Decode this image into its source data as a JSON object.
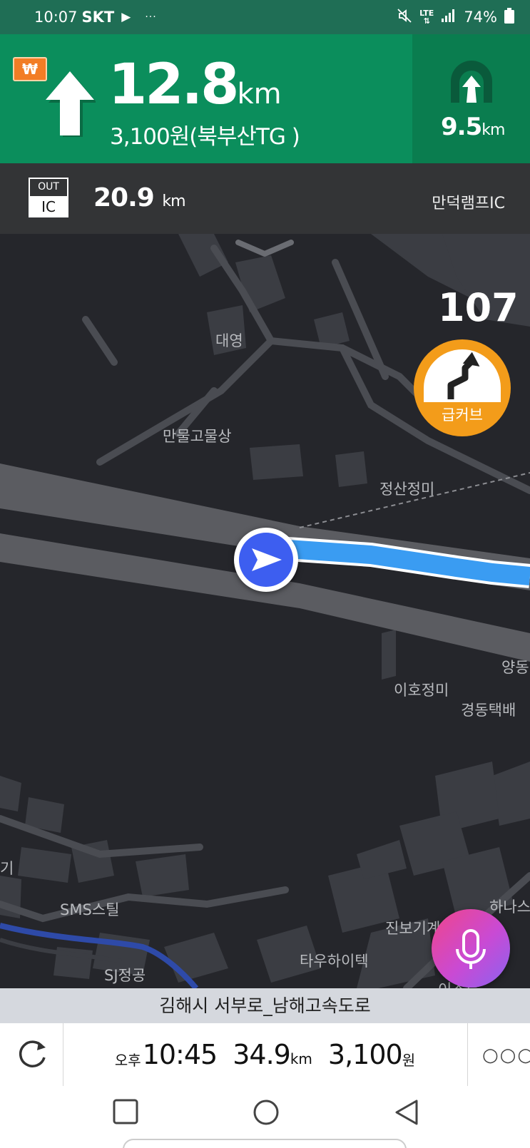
{
  "status_bar": {
    "time": "10:07",
    "carrier": "SKT",
    "battery": "74%",
    "dots": "···"
  },
  "guidance": {
    "toll_icon_symbol": "₩",
    "distance_value": "12.8",
    "distance_unit": "km",
    "toll_text": "3,100원(북부산TG )",
    "next_turn_icon": "straight-arrow-icon",
    "tunnel_icon": "tunnel-icon",
    "tunnel_distance_value": "9.5",
    "tunnel_distance_unit": "km",
    "accent_color": "#0b8e5c"
  },
  "exit": {
    "badge_top": "OUT",
    "badge_bottom": "IC",
    "distance_value": "20.9",
    "distance_unit": "km",
    "name": "만덕램프IC"
  },
  "map": {
    "speed_limit": "107",
    "curve_warning_label": "급커브",
    "route_color": "#3a9cf2",
    "labels": [
      {
        "text": "대영"
      },
      {
        "text": "만물고물상"
      },
      {
        "text": "정산정미"
      },
      {
        "text": "양동"
      },
      {
        "text": "이호정미"
      },
      {
        "text": "경동택배"
      },
      {
        "text": "SMS스틸"
      },
      {
        "text": "진보기계"
      },
      {
        "text": "하나스"
      },
      {
        "text": "타우하이텍"
      },
      {
        "text": "기"
      },
      {
        "text": "SJ정공"
      },
      {
        "text": "이스트"
      }
    ]
  },
  "road_name": "김해시 서부로_남해고속도로",
  "info_bar": {
    "eta_prefix": "오후",
    "eta_time": "10:45",
    "remaining_distance": "34.9",
    "remaining_distance_unit": "km",
    "toll_total": "3,100",
    "toll_unit": "원",
    "more_label": "○○○"
  }
}
